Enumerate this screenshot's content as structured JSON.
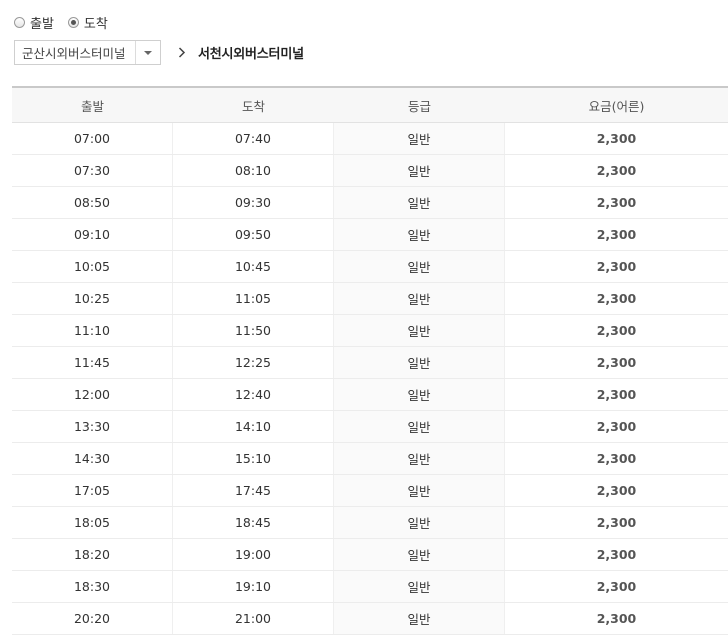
{
  "direction": {
    "options": [
      {
        "label": "출발",
        "checked": false
      },
      {
        "label": "도착",
        "checked": true
      }
    ]
  },
  "route": {
    "origin_select": "군산시외버스터미널",
    "destination": "서천시외버스터미널"
  },
  "table": {
    "headers": [
      "출발",
      "도착",
      "등급",
      "요금(어른)"
    ],
    "rows": [
      [
        "07:00",
        "07:40",
        "일반",
        "2,300"
      ],
      [
        "07:30",
        "08:10",
        "일반",
        "2,300"
      ],
      [
        "08:50",
        "09:30",
        "일반",
        "2,300"
      ],
      [
        "09:10",
        "09:50",
        "일반",
        "2,300"
      ],
      [
        "10:05",
        "10:45",
        "일반",
        "2,300"
      ],
      [
        "10:25",
        "11:05",
        "일반",
        "2,300"
      ],
      [
        "11:10",
        "11:50",
        "일반",
        "2,300"
      ],
      [
        "11:45",
        "12:25",
        "일반",
        "2,300"
      ],
      [
        "12:00",
        "12:40",
        "일반",
        "2,300"
      ],
      [
        "13:30",
        "14:10",
        "일반",
        "2,300"
      ],
      [
        "14:30",
        "15:10",
        "일반",
        "2,300"
      ],
      [
        "17:05",
        "17:45",
        "일반",
        "2,300"
      ],
      [
        "18:05",
        "18:45",
        "일반",
        "2,300"
      ],
      [
        "18:20",
        "19:00",
        "일반",
        "2,300"
      ],
      [
        "18:30",
        "19:10",
        "일반",
        "2,300"
      ],
      [
        "20:20",
        "21:00",
        "일반",
        "2,300"
      ]
    ]
  }
}
